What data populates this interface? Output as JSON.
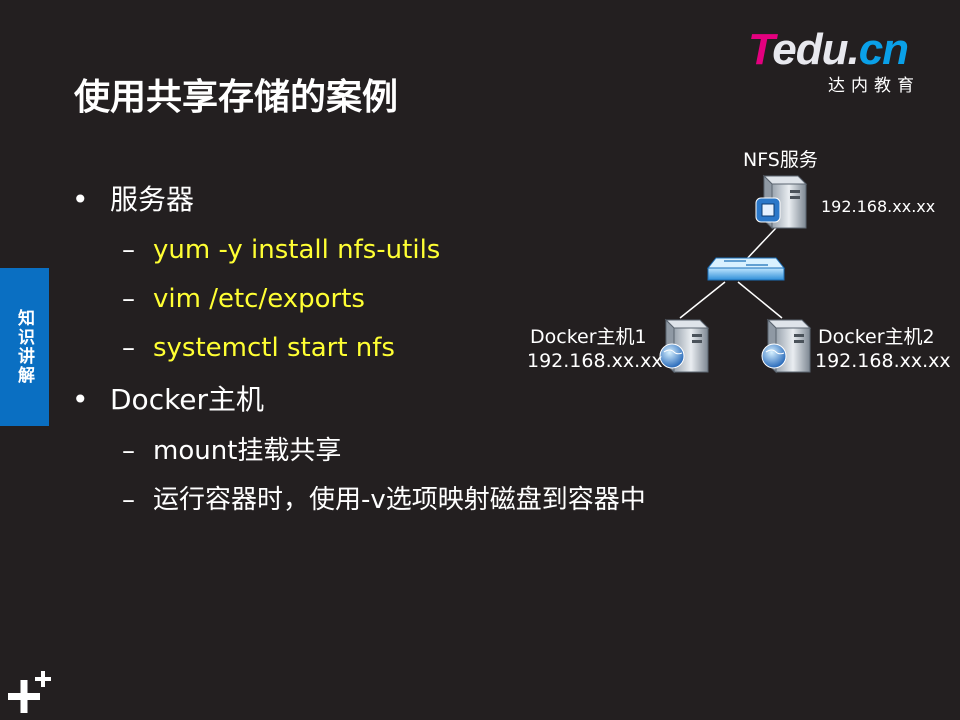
{
  "logo": {
    "t": "T",
    "edu": "edu.",
    "cn": "cn",
    "subtitle": "达内教育"
  },
  "slide": {
    "title": "使用共享存储的案例"
  },
  "side_tab": {
    "label": "知识讲解"
  },
  "bullets": {
    "bullet_glyph": "•",
    "dash_glyph": "–",
    "server_heading": "服务器",
    "server_steps": [
      "yum -y install  nfs-utils",
      "vim  /etc/exports",
      "systemctl  start nfs"
    ],
    "docker_heading": "Docker主机",
    "docker_steps": [
      "mount挂载共享",
      "运行容器时，使用-v选项映射磁盘到容器中"
    ]
  },
  "diagram": {
    "nfs": {
      "label": "NFS服务",
      "ip": "192.168.xx.xx"
    },
    "docker1": {
      "label": "Docker主机1",
      "ip": "192.168.xx.xx"
    },
    "docker2": {
      "label": "Docker主机2",
      "ip": "192.168.xx.xx"
    }
  },
  "colors": {
    "background": "#231f20",
    "highlight_yellow": "#ffff33",
    "side_tab_blue": "#0a6fc2",
    "logo_magenta": "#e4007f",
    "logo_blue": "#0aa0e8"
  }
}
